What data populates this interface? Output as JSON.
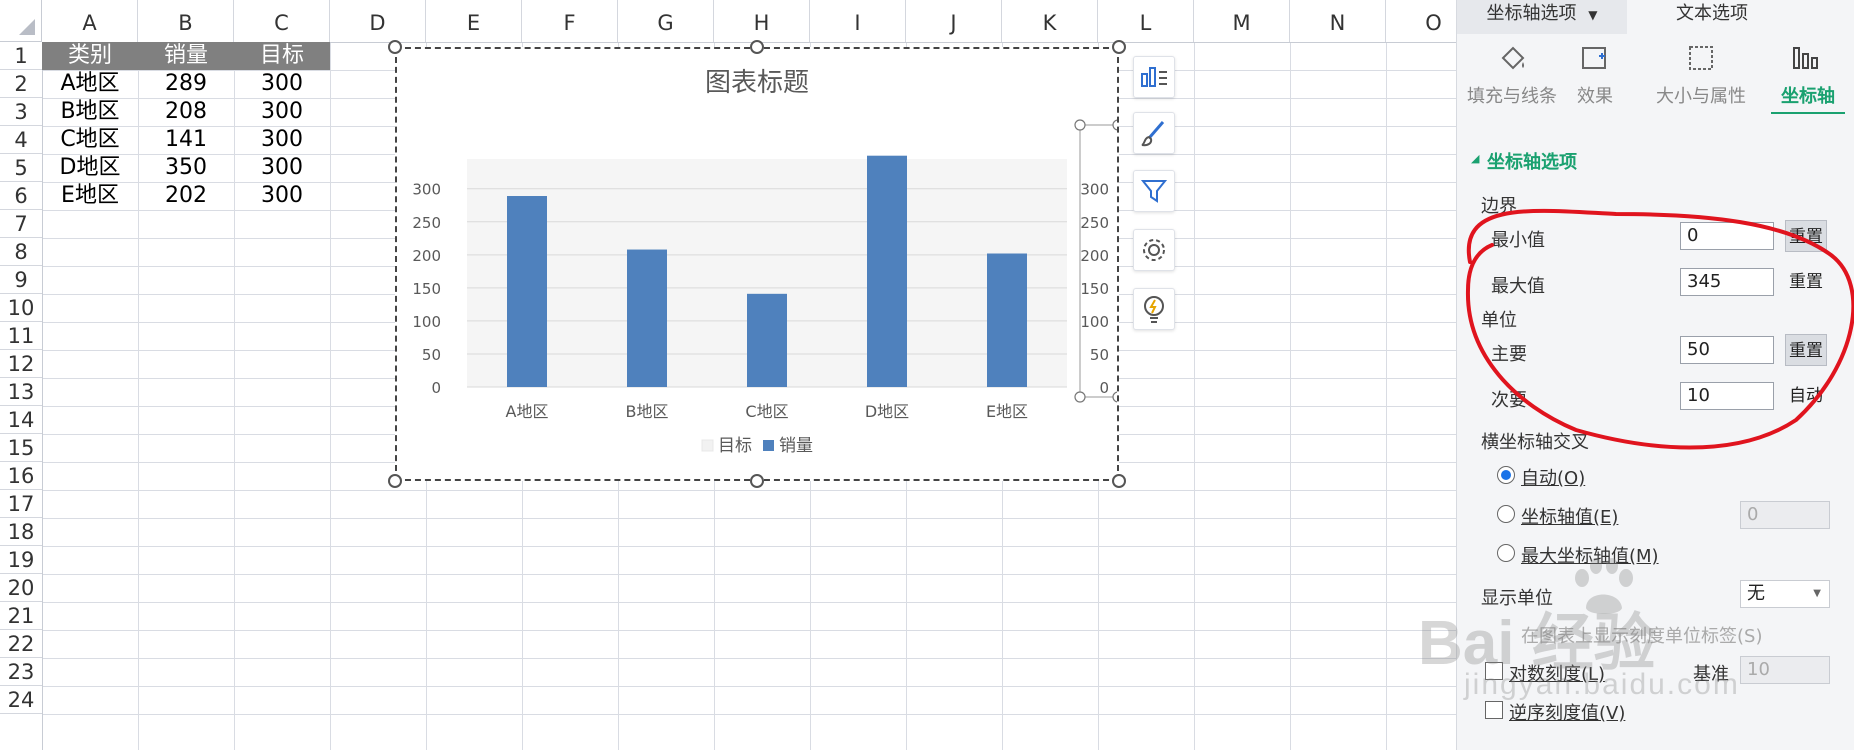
{
  "sheet": {
    "columns": [
      "A",
      "B",
      "C",
      "D",
      "E",
      "F",
      "G",
      "H",
      "I",
      "J",
      "K",
      "L",
      "M",
      "N",
      "O"
    ],
    "rows": [
      "1",
      "2",
      "3",
      "4",
      "5",
      "6",
      "7",
      "8",
      "9",
      "10",
      "11",
      "12",
      "13",
      "14",
      "15",
      "16",
      "17",
      "18",
      "19",
      "20",
      "21",
      "22",
      "23",
      "24"
    ],
    "table": {
      "headers": [
        "类别",
        "销量",
        "目标"
      ],
      "rows": [
        [
          "A地区",
          "289",
          "300"
        ],
        [
          "B地区",
          "208",
          "300"
        ],
        [
          "C地区",
          "141",
          "300"
        ],
        [
          "D地区",
          "350",
          "300"
        ],
        [
          "E地区",
          "202",
          "300"
        ]
      ]
    }
  },
  "chart": {
    "title": "图表标题",
    "colors": {
      "sales": "#4f81bd",
      "target": "#f2f2f2"
    },
    "tools": [
      "chart-elements-icon",
      "chart-style-brush-icon",
      "chart-filter-icon",
      "chart-settings-gear-icon",
      "chart-smart-bulb-icon"
    ]
  },
  "chart_data": {
    "type": "bar",
    "title": "图表标题",
    "categories": [
      "A地区",
      "B地区",
      "C地区",
      "D地区",
      "E地区"
    ],
    "series": [
      {
        "name": "销量",
        "values": [
          289,
          208,
          141,
          350,
          202
        ],
        "axis": "primary"
      },
      {
        "name": "目标",
        "values": [
          300,
          300,
          300,
          300,
          300
        ],
        "axis": "secondary"
      }
    ],
    "legend_order": [
      "目标",
      "销量"
    ],
    "y_ticks": [
      "0",
      "50",
      "100",
      "150",
      "200",
      "250",
      "300"
    ],
    "y2_ticks": [
      "0",
      "50",
      "100",
      "150",
      "200",
      "250",
      "300"
    ],
    "ylim": [
      0,
      345
    ],
    "y2lim": [
      0,
      345
    ],
    "legend_position": "bottom",
    "grid": true
  },
  "panel": {
    "tabs": [
      "坐标轴选项",
      "文本选项"
    ],
    "subtabs": [
      "填充与线条",
      "效果",
      "大小与属性",
      "坐标轴"
    ],
    "section_title": "坐标轴选项",
    "bounds_label": "边界",
    "min_label": "最小值",
    "min_value": "0",
    "max_label": "最大值",
    "max_value": "345",
    "reset_label": "重置",
    "unit_label": "单位",
    "major_label": "主要",
    "major_value": "50",
    "minor_label": "次要",
    "minor_value": "10",
    "auto_label": "自动",
    "cross_label": "横坐标轴交叉",
    "cross_auto": "自动(O)",
    "cross_axis_value": "坐标轴值(E)",
    "cross_axis_value_input": "0",
    "cross_max": "最大坐标轴值(M)",
    "display_unit_label": "显示单位",
    "display_unit_value": "无",
    "show_unit_label": "在图表上显示刻度单位标签(S)",
    "log_scale_label": "对数刻度(L)",
    "base_label": "基准",
    "base_value": "10",
    "reverse_label": "逆序刻度值(V)"
  },
  "watermark": {
    "brand": "Bai 经验",
    "url": "jingyan.baidu.com"
  }
}
